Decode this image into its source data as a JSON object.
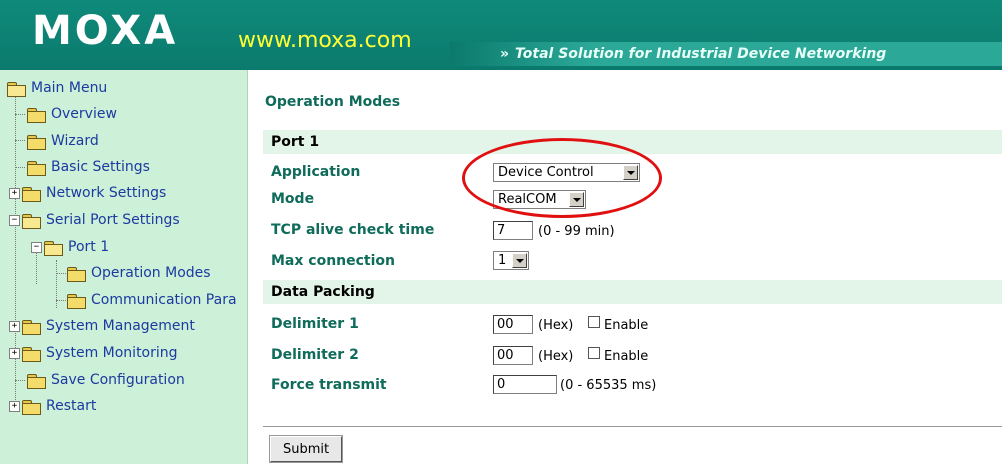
{
  "header": {
    "logo": "MOXA",
    "url": "www.moxa.com",
    "tagline_arrows": "»",
    "tagline": "Total Solution for Industrial Device Networking"
  },
  "sidebar": {
    "items": [
      {
        "label": "Main Menu",
        "icon": "folder-open-icon"
      },
      {
        "label": "Overview",
        "icon": "folder-icon"
      },
      {
        "label": "Wizard",
        "icon": "folder-icon"
      },
      {
        "label": "Basic Settings",
        "icon": "folder-icon"
      },
      {
        "label": "Network Settings",
        "icon": "folder-icon",
        "expander": "+"
      },
      {
        "label": "Serial Port Settings",
        "icon": "folder-open-icon",
        "expander": "−"
      },
      {
        "label": "Port 1",
        "icon": "folder-open-icon",
        "expander": "−"
      },
      {
        "label": "Operation Modes",
        "icon": "folder-icon"
      },
      {
        "label": "Communication Para",
        "icon": "folder-icon"
      },
      {
        "label": "System Management",
        "icon": "folder-icon",
        "expander": "+"
      },
      {
        "label": "System Monitoring",
        "icon": "folder-icon",
        "expander": "+"
      },
      {
        "label": "Save Configuration",
        "icon": "folder-icon"
      },
      {
        "label": "Restart",
        "icon": "folder-icon",
        "expander": "+"
      }
    ]
  },
  "main": {
    "title": "Operation Modes",
    "port_section": "Port 1",
    "application_label": "Application",
    "application_value": "Device Control",
    "mode_label": "Mode",
    "mode_value": "RealCOM",
    "tcp_alive_label": "TCP alive check time",
    "tcp_alive_value": "7",
    "tcp_alive_hint": "(0 - 99 min)",
    "max_connection_label": "Max connection",
    "max_connection_value": "1",
    "data_packing_section": "Data Packing",
    "delimiter1_label": "Delimiter 1",
    "delimiter1_value": "00",
    "delimiter1_hex": "(Hex)",
    "delimiter1_enable": "Enable",
    "delimiter2_label": "Delimiter 2",
    "delimiter2_value": "00",
    "delimiter2_hex": "(Hex)",
    "delimiter2_enable": "Enable",
    "force_transmit_label": "Force transmit",
    "force_transmit_value": "0",
    "force_transmit_hint": "(0 - 65535 ms)",
    "submit_label": "Submit"
  },
  "colors": {
    "header_bg": "#0b7a6d",
    "sidebar_bg": "#cdf0d8",
    "label_color": "#0f6b5a",
    "link_color": "#1c3aa0",
    "highlight": "#e01010"
  }
}
